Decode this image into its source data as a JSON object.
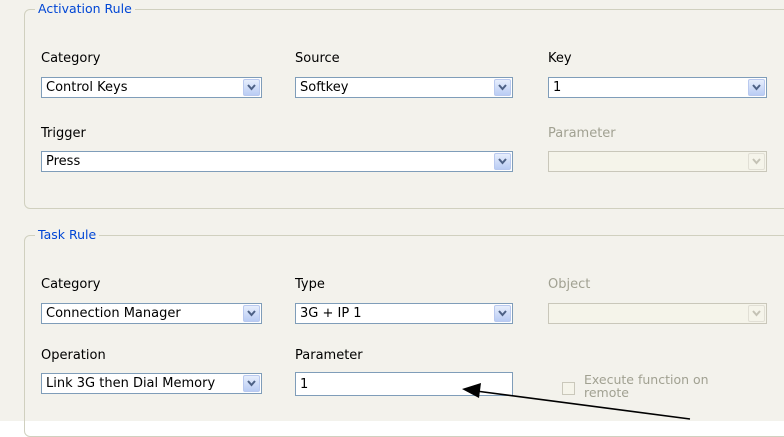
{
  "activation_rule": {
    "title": "Activation Rule",
    "category": {
      "label": "Category",
      "value": "Control Keys"
    },
    "source": {
      "label": "Source",
      "value": "Softkey"
    },
    "key": {
      "label": "Key",
      "value": "1"
    },
    "trigger": {
      "label": "Trigger",
      "value": "Press"
    },
    "parameter": {
      "label": "Parameter",
      "value": ""
    }
  },
  "task_rule": {
    "title": "Task Rule",
    "category": {
      "label": "Category",
      "value": "Connection Manager"
    },
    "type": {
      "label": "Type",
      "value": "3G + IP 1"
    },
    "object": {
      "label": "Object",
      "value": ""
    },
    "operation": {
      "label": "Operation",
      "value": "Link 3G then Dial Memory"
    },
    "parameter": {
      "label": "Parameter",
      "value": "1"
    },
    "execute_remote": {
      "label_line1": "Execute function on",
      "label_line2": "remote",
      "checked": false
    }
  },
  "colors": {
    "group_title": "#0046d5",
    "disabled_text": "#a1a192",
    "border": "#7f9db9",
    "panel_bg": "#f3f2ec"
  },
  "icons": {
    "dropdown": "chevron-down-icon",
    "annotation": "arrow-annotation"
  }
}
